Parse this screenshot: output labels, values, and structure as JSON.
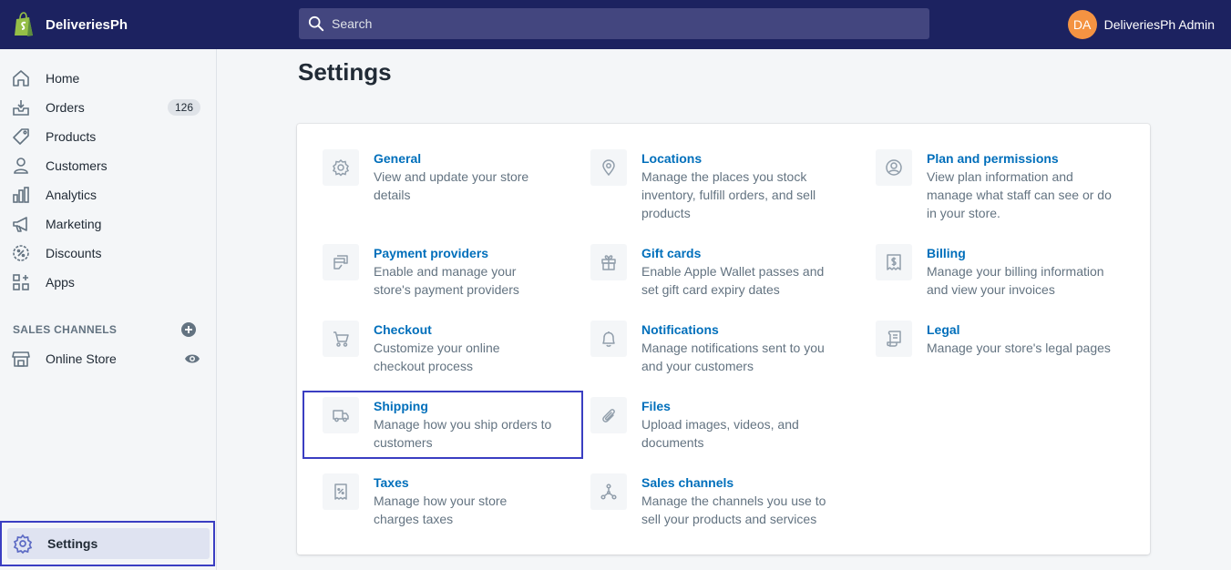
{
  "store": {
    "name": "DeliveriesPh"
  },
  "search": {
    "placeholder": "Search"
  },
  "user": {
    "initials": "DA",
    "name": "DeliveriesPh Admin",
    "avatar_color": "#f49342"
  },
  "colors": {
    "topbar": "#1c2260",
    "link": "#006fbb",
    "highlight": "#3a3ec2"
  },
  "sidebar": {
    "items": [
      {
        "label": "Home",
        "icon": "home-icon"
      },
      {
        "label": "Orders",
        "icon": "orders-icon",
        "badge": "126"
      },
      {
        "label": "Products",
        "icon": "tag-icon"
      },
      {
        "label": "Customers",
        "icon": "person-icon"
      },
      {
        "label": "Analytics",
        "icon": "bar-chart-icon"
      },
      {
        "label": "Marketing",
        "icon": "megaphone-icon"
      },
      {
        "label": "Discounts",
        "icon": "discount-icon"
      },
      {
        "label": "Apps",
        "icon": "apps-icon"
      }
    ],
    "sales_channels_label": "SALES CHANNELS",
    "online_store_label": "Online Store",
    "settings_label": "Settings"
  },
  "page": {
    "title": "Settings"
  },
  "settings": [
    {
      "title": "General",
      "desc": [
        "View and update your store",
        "details"
      ],
      "icon": "gear-icon"
    },
    {
      "title": "Locations",
      "desc": [
        "Manage the places you stock",
        "inventory, fulfill orders, and sell",
        "products"
      ],
      "icon": "location-pin-icon"
    },
    {
      "title": "Plan and permissions",
      "desc": [
        "View plan information and",
        "manage what staff can see or do",
        "in your store."
      ],
      "icon": "user-circle-icon"
    },
    {
      "title": "Payment providers",
      "desc": [
        "Enable and manage your",
        "store's payment providers"
      ],
      "icon": "payment-icon"
    },
    {
      "title": "Gift cards",
      "desc": [
        "Enable Apple Wallet passes and",
        "set gift card expiry dates"
      ],
      "icon": "gift-icon"
    },
    {
      "title": "Billing",
      "desc": [
        "Manage your billing information",
        "and view your invoices"
      ],
      "icon": "invoice-icon"
    },
    {
      "title": "Checkout",
      "desc": [
        "Customize your online",
        "checkout process"
      ],
      "icon": "cart-icon"
    },
    {
      "title": "Notifications",
      "desc": [
        "Manage notifications sent to you",
        "and your customers"
      ],
      "icon": "bell-icon"
    },
    {
      "title": "Legal",
      "desc": [
        "Manage your store's legal pages"
      ],
      "icon": "legal-document-icon"
    },
    {
      "title": "Shipping",
      "desc": [
        "Manage how you ship orders to",
        "customers"
      ],
      "icon": "truck-icon"
    },
    {
      "title": "Files",
      "desc": [
        "Upload images, videos, and",
        "documents"
      ],
      "icon": "paperclip-icon"
    },
    {
      "title": "Taxes",
      "desc": [
        "Manage how your store",
        "charges taxes"
      ],
      "icon": "tax-receipt-icon"
    },
    {
      "title": "Sales channels",
      "desc": [
        "Manage the channels you use to",
        "sell your products and services"
      ],
      "icon": "channels-icon"
    }
  ]
}
